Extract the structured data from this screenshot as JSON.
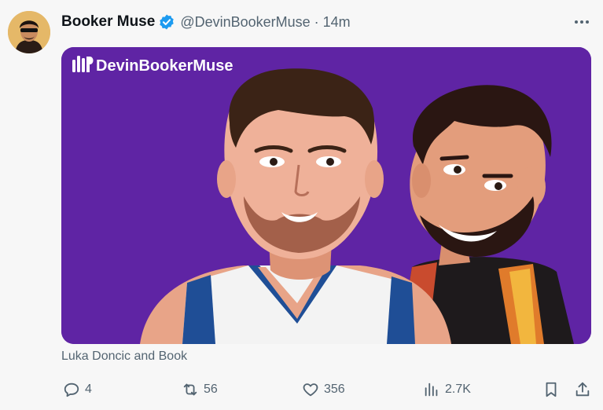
{
  "tweet": {
    "display_name": "Booker Muse",
    "handle": "@DevinBookerMuse",
    "separator": "·",
    "time": "14m",
    "image_brand": "DevinBookerMuse",
    "caption": "Luka Doncic and Book"
  },
  "actions": {
    "replies": "4",
    "reposts": "56",
    "likes": "356",
    "views": "2.7K"
  },
  "icons": {
    "verified": "verified-badge-icon",
    "more": "more-horizontal-icon",
    "reply": "reply-icon",
    "repost": "repost-icon",
    "like": "heart-icon",
    "views": "views-icon",
    "bookmark": "bookmark-icon",
    "share": "share-icon"
  },
  "colors": {
    "image_background": "#5f24a4",
    "verified": "#1d9bf0",
    "muted_text": "#536471"
  }
}
